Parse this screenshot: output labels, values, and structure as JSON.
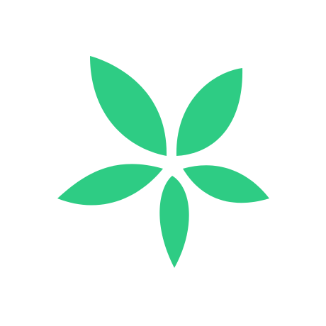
{
  "app_icon": {
    "name": "green-five-petal-flower-logo",
    "icon": "flower-icon",
    "colors": {
      "background": "#ffffff",
      "petal": "#2ecc84"
    }
  }
}
